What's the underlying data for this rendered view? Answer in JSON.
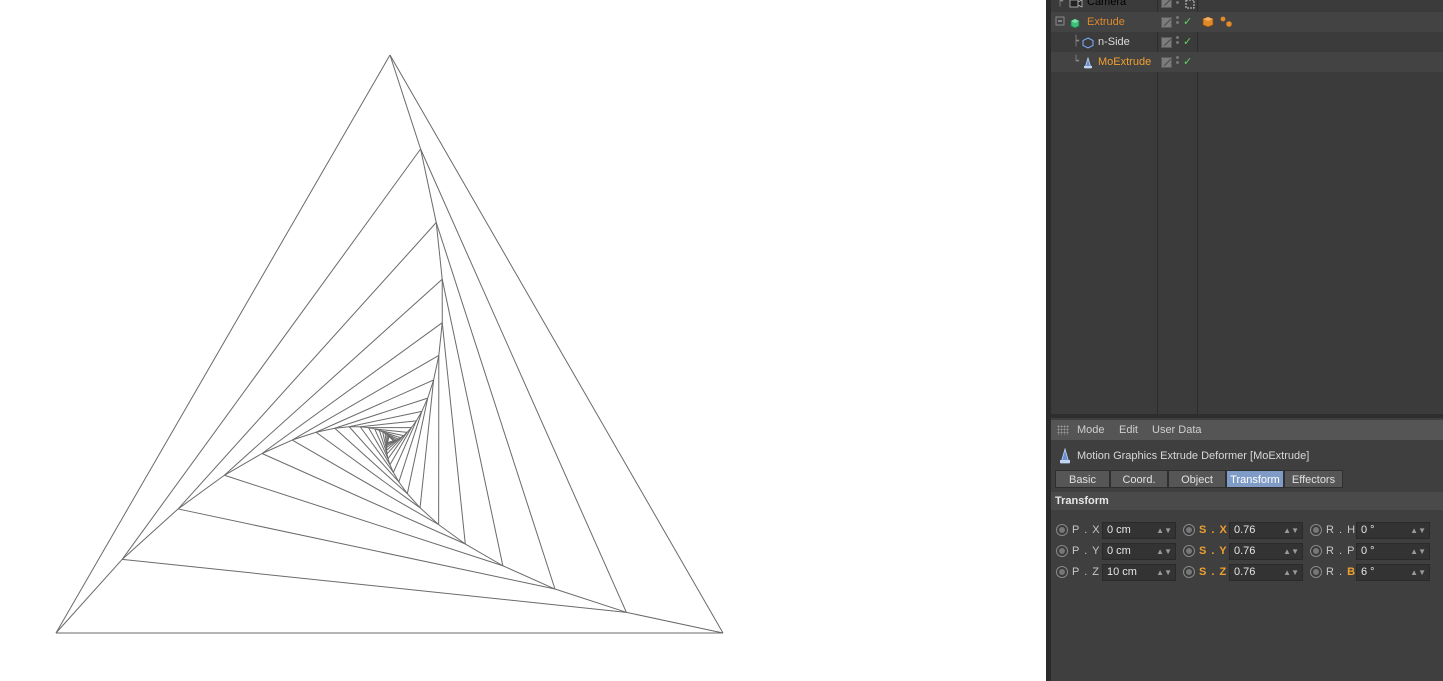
{
  "object_manager": {
    "rows": [
      {
        "name": "Camera",
        "color": "#dcdcdc",
        "icon": "camera-icon",
        "selected": false
      },
      {
        "name": "Extrude",
        "color": "#e08a2a",
        "icon": "extrude-icon",
        "selected": false
      },
      {
        "name": "n-Side",
        "color": "#dcdcdc",
        "icon": "nside-spline-icon",
        "selected": false
      },
      {
        "name": "MoExtrude",
        "color": "#f0a030",
        "icon": "moextrude-icon",
        "selected": true
      }
    ]
  },
  "attribute_manager": {
    "menu": [
      "Mode",
      "Edit",
      "User Data"
    ],
    "header_title": "Motion Graphics Extrude Deformer [MoExtrude]",
    "tabs": [
      "Basic",
      "Coord.",
      "Object",
      "Transform",
      "Effectors"
    ],
    "active_tab": "Transform",
    "section_title": "Transform",
    "params": [
      [
        {
          "label": "P . X",
          "value": "0 cm",
          "highlight": false
        },
        {
          "label": "S . X",
          "value": "0.76",
          "highlight": true
        },
        {
          "label": "R . H",
          "value": "0 °",
          "highlight": false
        }
      ],
      [
        {
          "label": "P . Y",
          "value": "0 cm",
          "highlight": false
        },
        {
          "label": "S . Y",
          "value": "0.76",
          "highlight": true
        },
        {
          "label": "R . P",
          "value": "0 °",
          "highlight": false
        }
      ],
      [
        {
          "label": "P . Z",
          "value": "10 cm",
          "highlight": false
        },
        {
          "label": "S . Z",
          "value": "0.76",
          "highlight": true
        },
        {
          "label": "R . B",
          "value": "6 °",
          "highlight": "partial"
        }
      ]
    ]
  },
  "colors": {
    "accent": "#f0a030",
    "tab_active": "#7f9cc7",
    "check": "#5fd15f"
  }
}
